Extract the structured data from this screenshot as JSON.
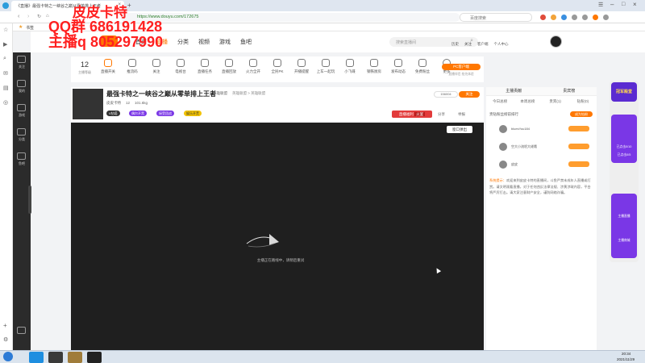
{
  "browser": {
    "tab_title": "《直播》最强卡特之一峡谷之巅从零单排上王者",
    "url": "https://www.douyu.com/172675",
    "search_placeholder": "百度搜索",
    "bookmark": "书签"
  },
  "overlay": {
    "line1": "皮皮卡特",
    "line2": "QQ群 686191428",
    "line3": "主播q 805297990"
  },
  "site_header": {
    "nav": [
      "首页",
      "直播",
      "分类",
      "视频",
      "游戏",
      "鱼吧"
    ],
    "search_placeholder": "搜索直播间",
    "user_links": [
      "历史",
      "关注",
      "客户端",
      "个人中心"
    ]
  },
  "toolbar": {
    "level_num": "12",
    "level_label": "主播等级",
    "items": [
      "直播开关",
      "推流码",
      "关注",
      "电视台",
      "直播任务",
      "直播回放",
      "火力全开",
      "全民PK",
      "开播提醒",
      "上车一起玩",
      "小飞碟",
      "钢铁厨房",
      "发布动态",
      "免费粉丝"
    ],
    "more_label": "更多",
    "pc_btn": "PC客户端",
    "pc_sub": "直播伴侣 抢先体验"
  },
  "room": {
    "title": "最强卡特之一峡谷之巅从零单排上王者",
    "category": "英雄联盟",
    "tags": "英雄联盟 > 英雄联盟",
    "streamer": "皮皮卡特",
    "level": "12",
    "hot": "101.6kg",
    "fans_count": "156004",
    "follow_btn": "关注",
    "share": "分享",
    "report": "举报",
    "vip_tag": "V钻塔",
    "badges": [
      "偶尔开黑",
      "接受团战",
      "娱乐开荒"
    ],
    "hot_btn": "直播福利",
    "hot_tab": "火宴"
  },
  "player": {
    "popout": "窗口弹出",
    "status": "主播正在路线中，请稍后重试"
  },
  "right_panel": {
    "tabs": [
      "主播贡献",
      "贵宾榜"
    ],
    "sub_tabs": [
      "今日总榜",
      "本周总榜",
      "贵宾(1)",
      "钻粉(0)"
    ],
    "rank_title": "贵钻粉丝榜前排行",
    "rank_btn": "成为钻粉",
    "ranks": [
      {
        "name": "bluesYou184"
      },
      {
        "name": "空大小流氓大佬哦"
      },
      {
        "name": "皮皮"
      }
    ],
    "notice_title": "系统提示：",
    "notice": "欢迎来到皮皮卡特的直播间，斗鱼严禁未成年人直播或打赏。请文明观看直播，对于任何违反法律法规、涉黄涉政内容，平台将严厉打击。请大家注意财产安全，谨防网络诈骗。"
  },
  "float_ad": {
    "badge": "冠军殿堂",
    "btn1": "已点击0/10",
    "btn2": "已点击0/5",
    "label1": "主播直播",
    "label2": "主播商城"
  },
  "taskbar": {
    "time": "20:34",
    "date": "2021/11/29"
  },
  "colors": {
    "brand": "#ff7700",
    "overlay": "#ff2020",
    "float": "#7a37e6",
    "dark_side": "#2b2b2b"
  }
}
